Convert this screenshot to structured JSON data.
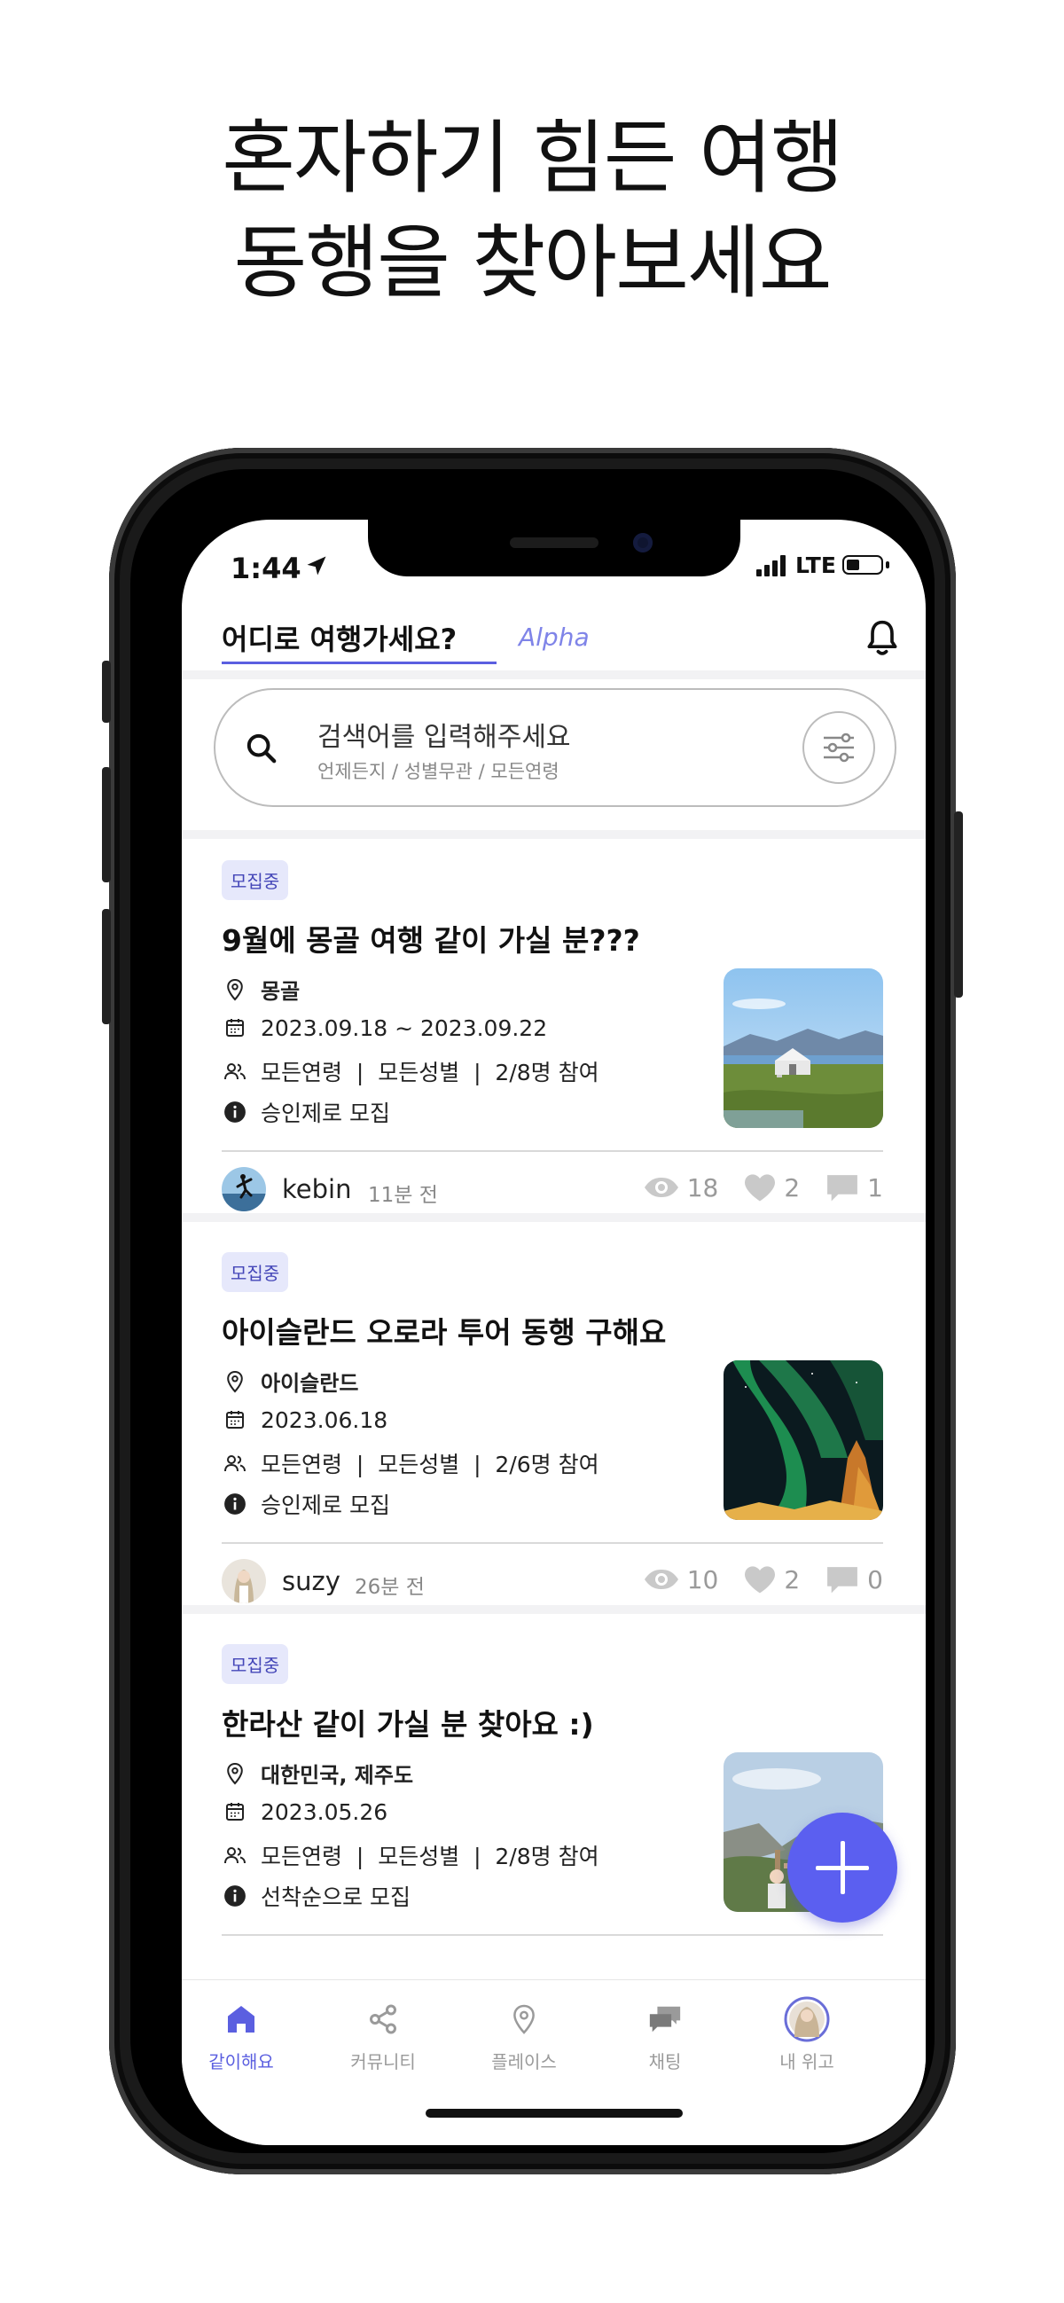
{
  "headline": {
    "line1": "혼자하기 힘든 여행",
    "line2": "동행을 찾아보세요"
  },
  "status_bar": {
    "time": "1:44",
    "network": "LTE"
  },
  "topnav": {
    "title": "어디로 여행가세요?",
    "alpha_label": "Alpha"
  },
  "search": {
    "placeholder": "검색어를 입력해주세요",
    "sub": "언제든지 / 성별무관 / 모든연령"
  },
  "posts": [
    {
      "badge": "모집중",
      "title": "9월에 몽골 여행 같이 가실 분???",
      "location": "몽골",
      "dates": "2023.09.18 ~ 2023.09.22",
      "conditions": "모든연령  |  모든성별  |  2/8명 참여",
      "recruit_type": "승인제로 모집",
      "author": "kebin",
      "time_ago": "11분 전",
      "views": "18",
      "likes": "2",
      "comments": "1"
    },
    {
      "badge": "모집중",
      "title": "아이슬란드 오로라 투어 동행 구해요",
      "location": "아이슬란드",
      "dates": "2023.06.18",
      "conditions": "모든연령  |  모든성별  |  2/6명 참여",
      "recruit_type": "승인제로 모집",
      "author": "suzy",
      "time_ago": "26분 전",
      "views": "10",
      "likes": "2",
      "comments": "0"
    },
    {
      "badge": "모집중",
      "title": "한라산 같이 가실 분 찾아요 :)",
      "location": "대한민국, 제주도",
      "dates": "2023.05.26",
      "conditions": "모든연령  |  모든성별  |  2/8명 참여",
      "recruit_type": "선착순으로 모집"
    }
  ],
  "tabs": [
    {
      "label": "같이해요",
      "icon": "home-icon",
      "active": true
    },
    {
      "label": "커뮤니티",
      "icon": "share-icon",
      "active": false
    },
    {
      "label": "플레이스",
      "icon": "pin-icon",
      "active": false
    },
    {
      "label": "채팅",
      "icon": "chat-icon",
      "active": false
    },
    {
      "label": "내 위고",
      "icon": "avatar",
      "active": false
    }
  ],
  "colors": {
    "accent": "#5b5fe0",
    "badge_bg": "#e6e8fb",
    "badge_text": "#4446b8",
    "fab": "#5b5ff0"
  }
}
